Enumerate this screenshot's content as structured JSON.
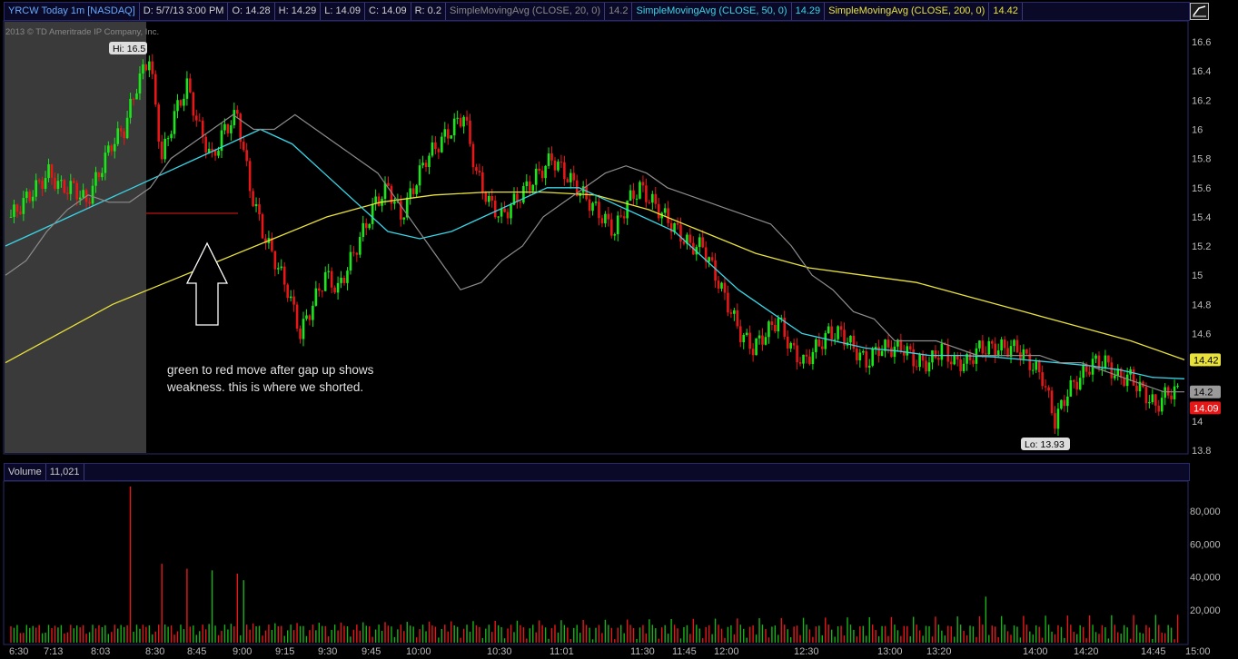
{
  "header": {
    "symbol": "YRCW Today 1m [NASDAQ]",
    "date": "D: 5/7/13 3:00 PM",
    "open": "O: 14.28",
    "high": "H: 14.29",
    "low": "L: 14.09",
    "close": "C: 14.09",
    "range": "R: 0.2",
    "sma20_label": "SimpleMovingAvg (CLOSE, 20, 0)",
    "sma20_value": "14.2",
    "sma50_label": "SimpleMovingAvg (CLOSE, 50, 0)",
    "sma50_value": "14.29",
    "sma200_label": "SimpleMovingAvg (CLOSE, 200, 0)",
    "sma200_value": "14.42"
  },
  "copyright": "2013 © TD Ameritrade IP Company, Inc.",
  "volume_header": {
    "label": "Volume",
    "value": "11,021"
  },
  "annotation": "green to red move after gap up shows weakness. this is where we shorted.",
  "colors": {
    "up": "#17e817",
    "down": "#e81717",
    "sma20": "#8c8c8c",
    "sma50": "#38d6e8",
    "sma200": "#e8e23a",
    "premarket_bg": "#3a3a3a",
    "volume": "#17b317"
  },
  "icons": {
    "config": "chart-settings-icon",
    "arrow": "up-arrow-icon"
  },
  "chart_data": {
    "type": "candlestick",
    "title": "YRCW Today 1m [NASDAQ]",
    "price_axis": {
      "ylim": [
        13.8,
        16.7
      ],
      "ticks": [
        "13.8",
        "14",
        "14.2",
        "14.4",
        "14.6",
        "14.8",
        "15",
        "15.2",
        "15.4",
        "15.6",
        "15.8",
        "16",
        "16.2",
        "16.4",
        "16.6"
      ]
    },
    "volume_axis": {
      "ylim": [
        0,
        95000
      ],
      "ticks": [
        "20,000",
        "40,000",
        "60,000",
        "80,000"
      ]
    },
    "time_ticks": [
      "6:30",
      "7:13",
      "8:03",
      "8:30",
      "8:45",
      "9:00",
      "9:15",
      "9:30",
      "9:45",
      "10:00",
      "10:30",
      "11:01",
      "11:30",
      "11:45",
      "12:00",
      "12:30",
      "13:00",
      "13:20",
      "14:00",
      "14:20",
      "14:45",
      "15:00"
    ],
    "price_labels": {
      "high": "Hi: 16.5",
      "low": "Lo: 13.93",
      "sma20": "14.2",
      "close": "14.09",
      "sma200": "14.42"
    },
    "series": {
      "close": [
        15.4,
        15.5,
        15.6,
        15.7,
        15.6,
        15.6,
        15.5,
        15.7,
        15.9,
        16.0,
        16.3,
        16.5,
        15.8,
        16.1,
        16.3,
        16.0,
        15.8,
        16.0,
        16.1,
        15.6,
        15.3,
        15.1,
        14.9,
        14.6,
        14.8,
        15.0,
        14.9,
        15.1,
        15.3,
        15.5,
        15.6,
        15.4,
        15.6,
        15.8,
        15.9,
        16.0,
        16.1,
        15.7,
        15.5,
        15.4,
        15.5,
        15.6,
        15.7,
        15.8,
        15.7,
        15.6,
        15.5,
        15.4,
        15.3,
        15.5,
        15.6,
        15.5,
        15.4,
        15.3,
        15.2,
        15.2,
        15.0,
        14.8,
        14.6,
        14.5,
        14.6,
        14.7,
        14.5,
        14.4,
        14.5,
        14.6,
        14.6,
        14.5,
        14.4,
        14.5,
        14.5,
        14.5,
        14.4,
        14.4,
        14.5,
        14.4,
        14.4,
        14.5,
        14.5,
        14.5,
        14.5,
        14.4,
        14.3,
        14.0,
        14.2,
        14.3,
        14.4,
        14.4,
        14.3,
        14.3,
        14.2,
        14.1,
        14.2
      ],
      "sma20": [
        15.0,
        15.1,
        15.3,
        15.45,
        15.55,
        15.5,
        15.5,
        15.6,
        15.8,
        15.9,
        16.0,
        16.1,
        16.0,
        16.0,
        16.1,
        16.0,
        15.9,
        15.8,
        15.7,
        15.5,
        15.3,
        15.1,
        14.9,
        14.95,
        15.1,
        15.2,
        15.4,
        15.5,
        15.6,
        15.7,
        15.75,
        15.7,
        15.6,
        15.55,
        15.5,
        15.45,
        15.4,
        15.35,
        15.2,
        15.0,
        14.9,
        14.75,
        14.7,
        14.55,
        14.55,
        14.55,
        14.5,
        14.45,
        14.45,
        14.45,
        14.45,
        14.4,
        14.4,
        14.35,
        14.3,
        14.25,
        14.2,
        14.2
      ],
      "sma50": [
        15.2,
        15.3,
        15.4,
        15.5,
        15.6,
        15.7,
        15.8,
        15.9,
        16.0,
        15.9,
        15.7,
        15.5,
        15.3,
        15.25,
        15.3,
        15.4,
        15.5,
        15.6,
        15.6,
        15.5,
        15.4,
        15.3,
        15.1,
        14.9,
        14.75,
        14.6,
        14.55,
        14.5,
        14.48,
        14.45,
        14.45,
        14.44,
        14.42,
        14.4,
        14.38,
        14.35,
        14.3,
        14.29
      ],
      "sma200": [
        14.4,
        14.6,
        14.8,
        14.95,
        15.1,
        15.25,
        15.4,
        15.5,
        15.55,
        15.57,
        15.57,
        15.55,
        15.45,
        15.3,
        15.15,
        15.05,
        15.0,
        14.95,
        14.85,
        14.75,
        14.65,
        14.55,
        14.42
      ]
    },
    "volume_peak": 95000
  }
}
